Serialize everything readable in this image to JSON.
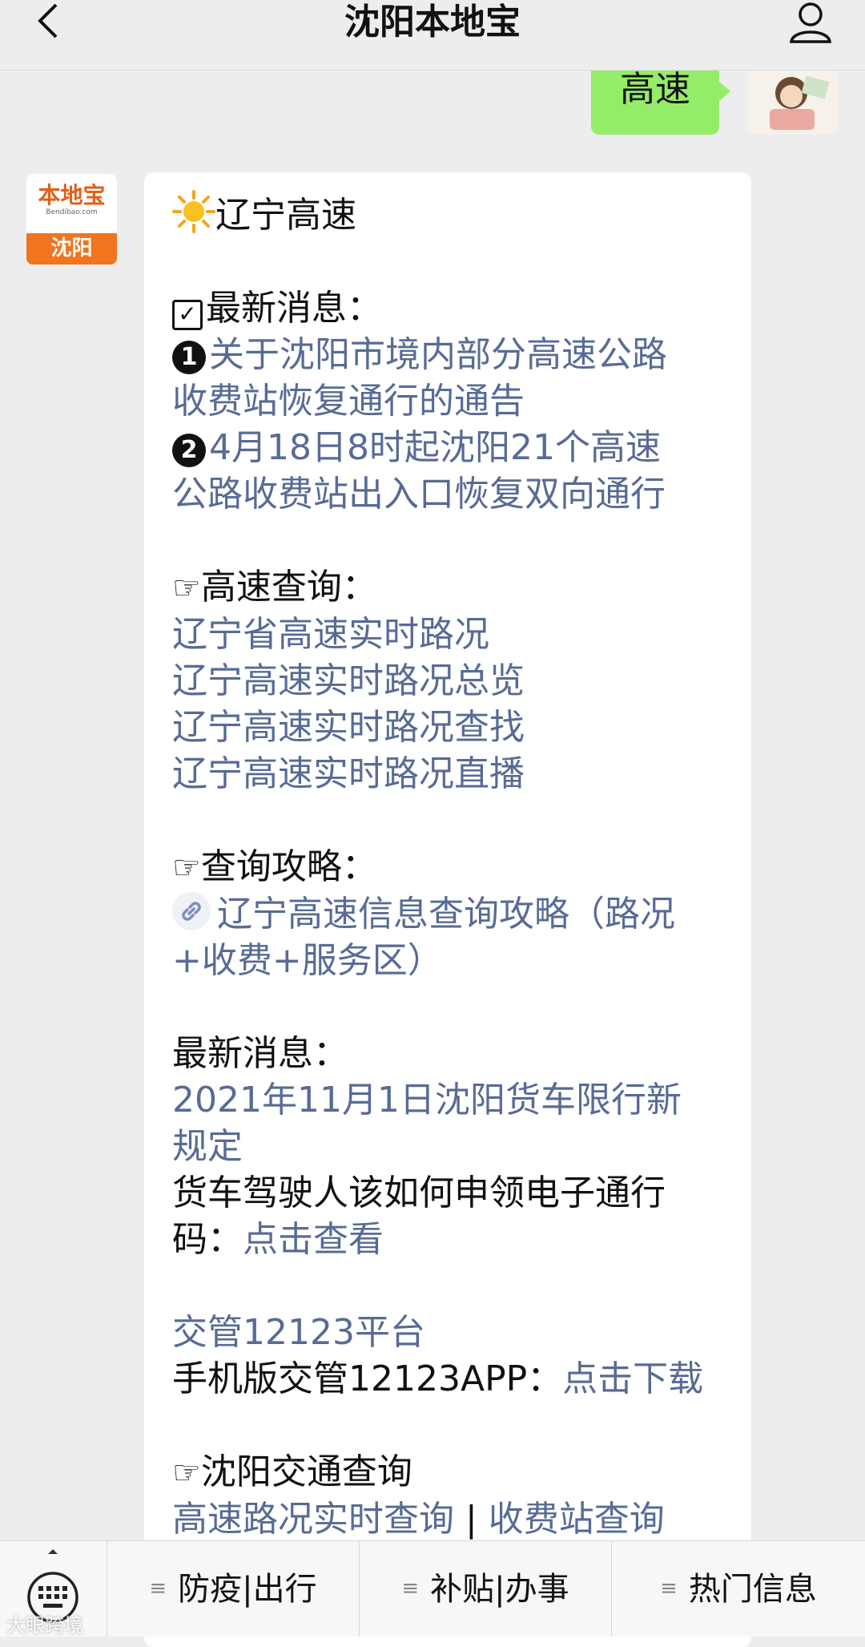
{
  "header": {
    "title": "沈阳本地宝",
    "back_icon": "chevron-left-icon",
    "user_icon": "person-icon"
  },
  "outgoing": {
    "text": "高速"
  },
  "bot": {
    "logo_text": "本地宝",
    "logo_sub": "Bendibao.com",
    "city": "沈阳"
  },
  "message": {
    "title": "辽宁高速",
    "latest_heading": "最新消息：",
    "news": [
      {
        "badge": "1",
        "lines": [
          "关于沈阳市境内部分高速公路",
          "收费站恢复通行的通告"
        ]
      },
      {
        "badge": "2",
        "lines": [
          "4月18日8时起沈阳21个高速",
          "公路收费站出入口恢复双向通行"
        ]
      }
    ],
    "query_heading": "高速查询：",
    "query_links": [
      "辽宁省高速实时路况",
      "辽宁高速实时路况总览",
      "辽宁高速实时路况查找",
      "辽宁高速实时路况直播"
    ],
    "guide_heading": "查询攻略：",
    "guide_lines": [
      "辽宁高速信息查询攻略（路况",
      "+收费+服务区）"
    ],
    "latest2_heading": "最新消息：",
    "latest2_links": [
      "2021年11月1日沈阳货车限行新",
      "规定"
    ],
    "truck_text_1": "货车驾驶人该如何申领电子通行",
    "truck_text_2": "码：",
    "truck_link": "点击查看",
    "platform_link": "交管12123平台",
    "app_text": "手机版交管12123APP：",
    "app_link": "点击下载",
    "traffic_heading": "沈阳交通查询",
    "traffic_link_1": "高速路况实时查询",
    "traffic_sep": " | ",
    "traffic_link_2": "收费站查询"
  },
  "bottom_menu": {
    "keyboard_icon": "keyboard-icon",
    "items": [
      {
        "label": "防疫|出行"
      },
      {
        "label": "补贴|办事"
      },
      {
        "label": "热门信息"
      }
    ]
  },
  "watermark": "大眼跨境",
  "colors": {
    "link": "#576b95",
    "bubble_green": "#95ec69",
    "background": "#ededed"
  }
}
